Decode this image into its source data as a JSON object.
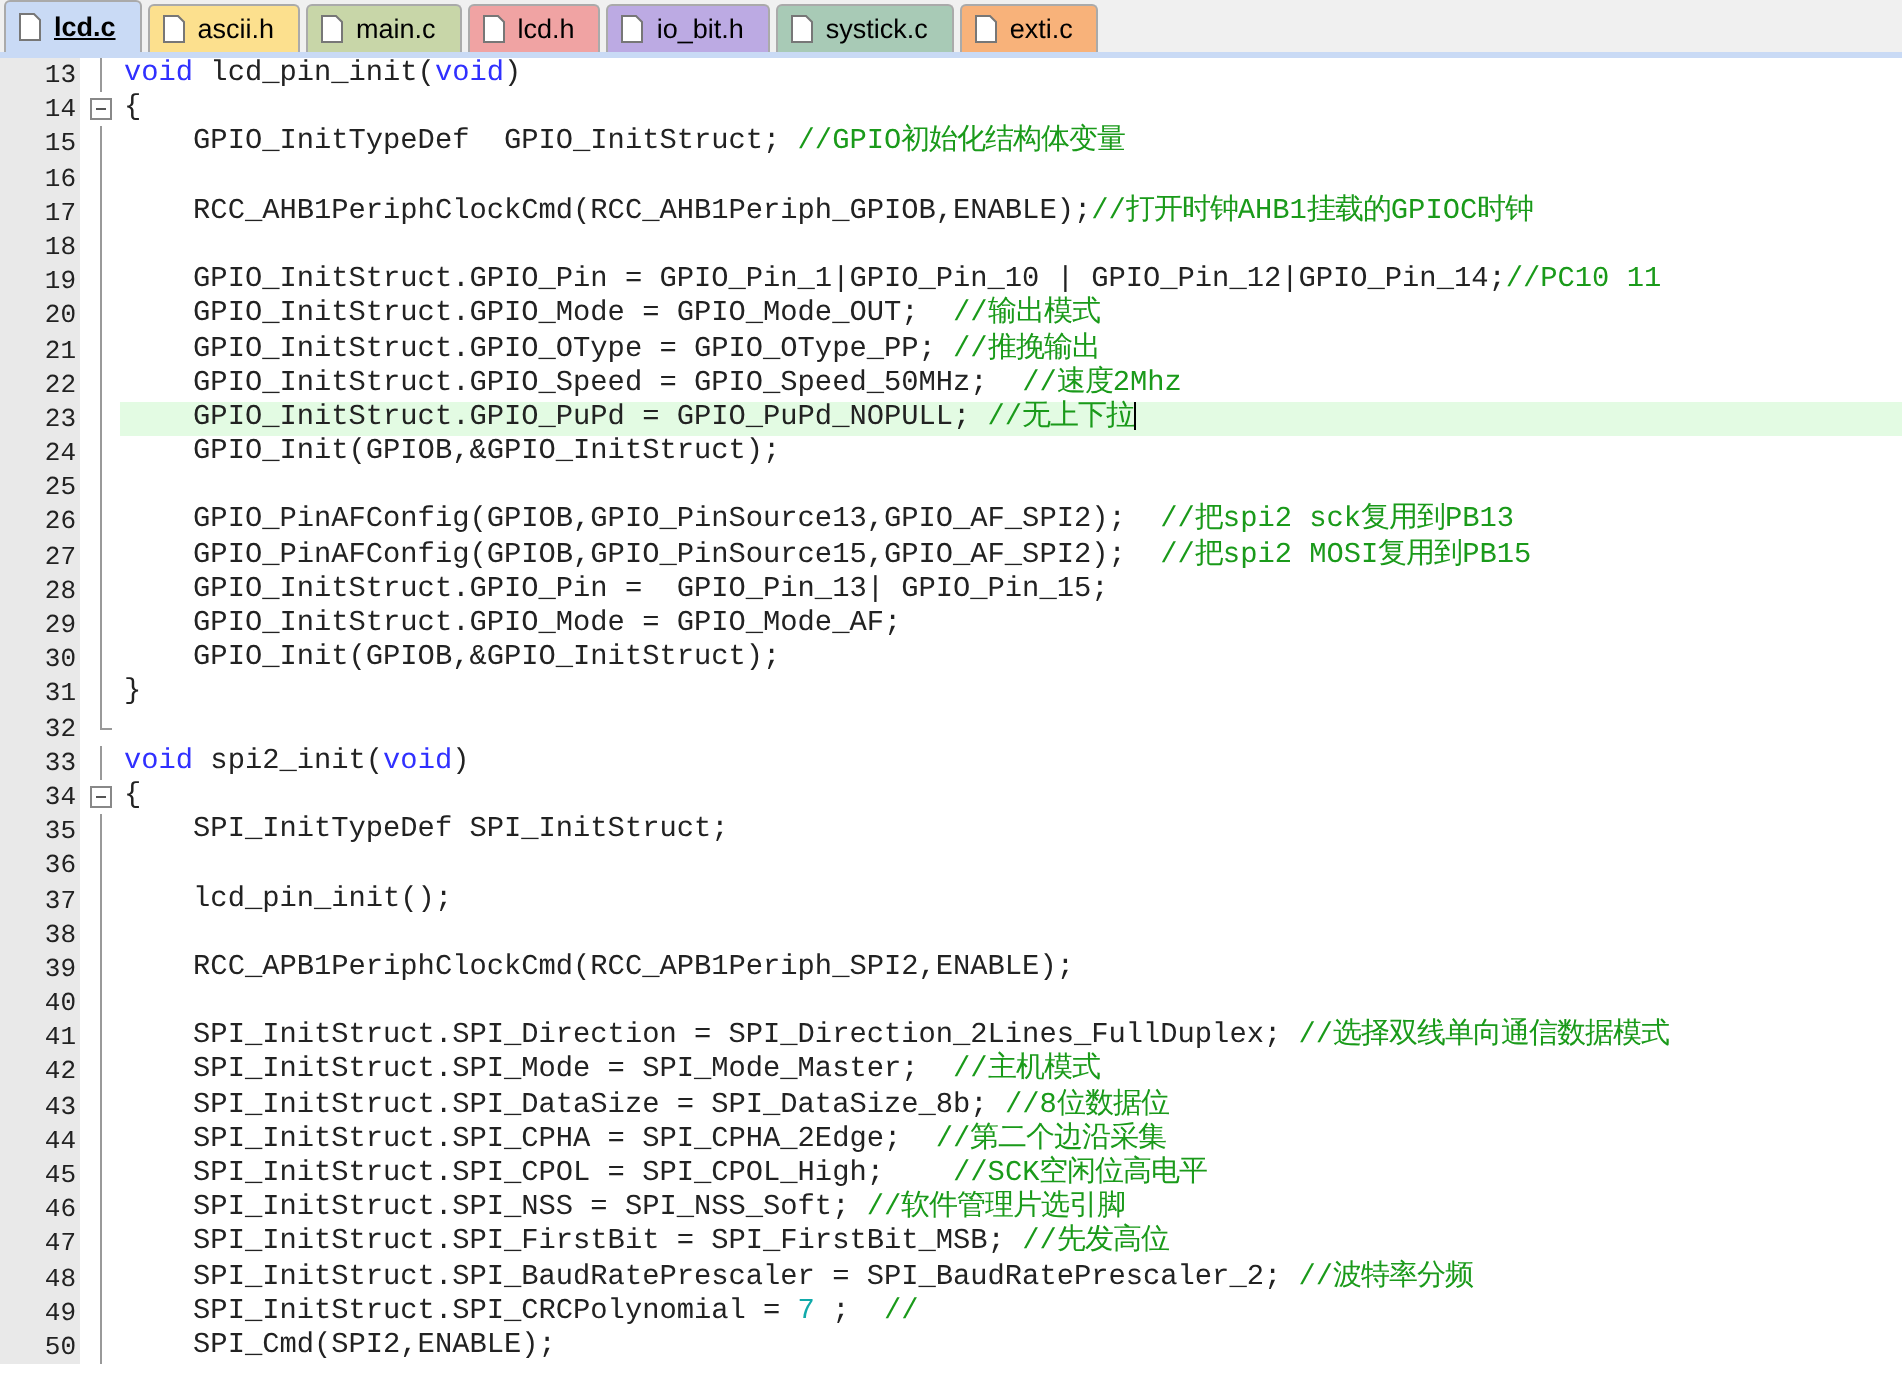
{
  "tabs": [
    {
      "label": "lcd.c",
      "color": "#c9daf5",
      "selected": true
    },
    {
      "label": "ascii.h",
      "color": "#fce08e",
      "selected": false
    },
    {
      "label": "main.c",
      "color": "#c8d6a8",
      "selected": false
    },
    {
      "label": "lcd.h",
      "color": "#f0a3a3",
      "selected": false
    },
    {
      "label": "io_bit.h",
      "color": "#bcaae3",
      "selected": false
    },
    {
      "label": "systick.c",
      "color": "#a8cab6",
      "selected": false
    },
    {
      "label": "exti.c",
      "color": "#f8b27a",
      "selected": false
    }
  ],
  "editor": {
    "lines": [
      {
        "n": "13",
        "kind": "plain",
        "current": false,
        "parts": [
          {
            "kind": "keyword",
            "text": "void"
          },
          {
            "kind": "code",
            "text": " lcd_pin_init("
          },
          {
            "kind": "keyword",
            "text": "void"
          },
          {
            "kind": "code",
            "text": ")"
          }
        ]
      },
      {
        "n": "14",
        "kind": "foldstart",
        "current": false,
        "parts": [
          {
            "kind": "code",
            "text": "{"
          }
        ]
      },
      {
        "n": "15",
        "kind": "plain",
        "current": false,
        "parts": [
          {
            "kind": "code",
            "text": "    GPIO_InitTypeDef  GPIO_InitStruct; "
          },
          {
            "kind": "comment",
            "text": "//GPIO初始化结构体变量"
          }
        ]
      },
      {
        "n": "16",
        "kind": "plain",
        "current": false
      },
      {
        "n": "17",
        "kind": "plain",
        "current": false,
        "parts": [
          {
            "kind": "code",
            "text": "    RCC_AHB1PeriphClockCmd(RCC_AHB1Periph_GPIOB,ENABLE);"
          },
          {
            "kind": "comment",
            "text": "//打开时钟AHB1挂载的GPIOC时钟"
          }
        ]
      },
      {
        "n": "18",
        "kind": "plain",
        "current": false
      },
      {
        "n": "19",
        "kind": "plain",
        "current": false,
        "parts": [
          {
            "kind": "code",
            "text": "    GPIO_InitStruct.GPIO_Pin = GPIO_Pin_1|GPIO_Pin_10 | GPIO_Pin_12|GPIO_Pin_14;"
          },
          {
            "kind": "comment",
            "text": "//PC10 11"
          }
        ]
      },
      {
        "n": "20",
        "kind": "plain",
        "current": false,
        "parts": [
          {
            "kind": "code",
            "text": "    GPIO_InitStruct.GPIO_Mode = GPIO_Mode_OUT;  "
          },
          {
            "kind": "comment",
            "text": "//输出模式"
          }
        ]
      },
      {
        "n": "21",
        "kind": "plain",
        "current": false,
        "parts": [
          {
            "kind": "code",
            "text": "    GPIO_InitStruct.GPIO_OType = GPIO_OType_PP; "
          },
          {
            "kind": "comment",
            "text": "//推挽输出"
          }
        ]
      },
      {
        "n": "22",
        "kind": "plain",
        "current": false,
        "parts": [
          {
            "kind": "code",
            "text": "    GPIO_InitStruct.GPIO_Speed = GPIO_Speed_50MHz;  "
          },
          {
            "kind": "comment",
            "text": "//速度2Mhz"
          }
        ]
      },
      {
        "n": "23",
        "kind": "plain",
        "current": true,
        "parts": [
          {
            "kind": "code",
            "text": "    GPIO_InitStruct.GPIO_PuPd = GPIO_PuPd_NOPULL; "
          },
          {
            "kind": "comment",
            "text": "//无上下拉"
          }
        ]
      },
      {
        "n": "24",
        "kind": "plain",
        "current": false,
        "parts": [
          {
            "kind": "code",
            "text": "    GPIO_Init(GPIOB,&GPIO_InitStruct);"
          }
        ]
      },
      {
        "n": "25",
        "kind": "plain",
        "current": false
      },
      {
        "n": "26",
        "kind": "plain",
        "current": false,
        "parts": [
          {
            "kind": "code",
            "text": "    GPIO_PinAFConfig(GPIOB,GPIO_PinSource13,GPIO_AF_SPI2);  "
          },
          {
            "kind": "comment",
            "text": "//把spi2 sck复用到PB13"
          }
        ]
      },
      {
        "n": "27",
        "kind": "plain",
        "current": false,
        "parts": [
          {
            "kind": "code",
            "text": "    GPIO_PinAFConfig(GPIOB,GPIO_PinSource15,GPIO_AF_SPI2);  "
          },
          {
            "kind": "comment",
            "text": "//把spi2 MOSI复用到PB15"
          }
        ]
      },
      {
        "n": "28",
        "kind": "plain",
        "current": false,
        "parts": [
          {
            "kind": "code",
            "text": "    GPIO_InitStruct.GPIO_Pin =  GPIO_Pin_13| GPIO_Pin_15;"
          }
        ]
      },
      {
        "n": "29",
        "kind": "plain",
        "current": false,
        "parts": [
          {
            "kind": "code",
            "text": "    GPIO_InitStruct.GPIO_Mode = GPIO_Mode_AF;"
          }
        ]
      },
      {
        "n": "30",
        "kind": "plain",
        "current": false,
        "parts": [
          {
            "kind": "code",
            "text": "    GPIO_Init(GPIOB,&GPIO_InitStruct);"
          }
        ]
      },
      {
        "n": "31",
        "kind": "plain",
        "current": false,
        "parts": [
          {
            "kind": "code",
            "text": "}"
          }
        ]
      },
      {
        "n": "32",
        "kind": "foldend",
        "current": false
      },
      {
        "n": "33",
        "kind": "plain",
        "current": false,
        "parts": [
          {
            "kind": "keyword",
            "text": "void"
          },
          {
            "kind": "code",
            "text": " spi2_init("
          },
          {
            "kind": "keyword",
            "text": "void"
          },
          {
            "kind": "code",
            "text": ")"
          }
        ]
      },
      {
        "n": "34",
        "kind": "foldstart",
        "current": false,
        "parts": [
          {
            "kind": "code",
            "text": "{"
          }
        ]
      },
      {
        "n": "35",
        "kind": "plain",
        "current": false,
        "parts": [
          {
            "kind": "code",
            "text": "    SPI_InitTypeDef SPI_InitStruct;"
          }
        ]
      },
      {
        "n": "36",
        "kind": "plain",
        "current": false
      },
      {
        "n": "37",
        "kind": "plain",
        "current": false,
        "parts": [
          {
            "kind": "code",
            "text": "    lcd_pin_init();"
          }
        ]
      },
      {
        "n": "38",
        "kind": "plain",
        "current": false
      },
      {
        "n": "39",
        "kind": "plain",
        "current": false,
        "parts": [
          {
            "kind": "code",
            "text": "    RCC_APB1PeriphClockCmd(RCC_APB1Periph_SPI2,ENABLE);"
          }
        ]
      },
      {
        "n": "40",
        "kind": "plain",
        "current": false
      },
      {
        "n": "41",
        "kind": "plain",
        "current": false,
        "parts": [
          {
            "kind": "code",
            "text": "    SPI_InitStruct.SPI_Direction = SPI_Direction_2Lines_FullDuplex; "
          },
          {
            "kind": "comment",
            "text": "//选择双线单向通信数据模式"
          }
        ]
      },
      {
        "n": "42",
        "kind": "plain",
        "current": false,
        "parts": [
          {
            "kind": "code",
            "text": "    SPI_InitStruct.SPI_Mode = SPI_Mode_Master;  "
          },
          {
            "kind": "comment",
            "text": "//主机模式"
          }
        ]
      },
      {
        "n": "43",
        "kind": "plain",
        "current": false,
        "parts": [
          {
            "kind": "code",
            "text": "    SPI_InitStruct.SPI_DataSize = SPI_DataSize_8b; "
          },
          {
            "kind": "comment",
            "text": "//8位数据位"
          }
        ]
      },
      {
        "n": "44",
        "kind": "plain",
        "current": false,
        "parts": [
          {
            "kind": "code",
            "text": "    SPI_InitStruct.SPI_CPHA = SPI_CPHA_2Edge;  "
          },
          {
            "kind": "comment",
            "text": "//第二个边沿采集"
          }
        ]
      },
      {
        "n": "45",
        "kind": "plain",
        "current": false,
        "parts": [
          {
            "kind": "code",
            "text": "    SPI_InitStruct.SPI_CPOL = SPI_CPOL_High;    "
          },
          {
            "kind": "comment",
            "text": "//SCK空闲位高电平"
          }
        ]
      },
      {
        "n": "46",
        "kind": "plain",
        "current": false,
        "parts": [
          {
            "kind": "code",
            "text": "    SPI_InitStruct.SPI_NSS = SPI_NSS_Soft; "
          },
          {
            "kind": "comment",
            "text": "//软件管理片选引脚"
          }
        ]
      },
      {
        "n": "47",
        "kind": "plain",
        "current": false,
        "parts": [
          {
            "kind": "code",
            "text": "    SPI_InitStruct.SPI_FirstBit = SPI_FirstBit_MSB; "
          },
          {
            "kind": "comment",
            "text": "//先发高位"
          }
        ]
      },
      {
        "n": "48",
        "kind": "plain",
        "current": false,
        "parts": [
          {
            "kind": "code",
            "text": "    SPI_InitStruct.SPI_BaudRatePrescaler = SPI_BaudRatePrescaler_2; "
          },
          {
            "kind": "comment",
            "text": "//波特率分频"
          }
        ]
      },
      {
        "n": "49",
        "kind": "plain",
        "current": false,
        "parts": [
          {
            "kind": "code",
            "text": "    SPI_InitStruct.SPI_CRCPolynomial = "
          },
          {
            "kind": "number",
            "text": "7"
          },
          {
            "kind": "code",
            "text": " ;  "
          },
          {
            "kind": "comment",
            "text": "//"
          }
        ]
      },
      {
        "n": "50",
        "kind": "plain",
        "current": false,
        "parts": [
          {
            "kind": "code",
            "text": "    SPI_Cmd(SPI2,ENABLE);"
          }
        ]
      }
    ]
  }
}
